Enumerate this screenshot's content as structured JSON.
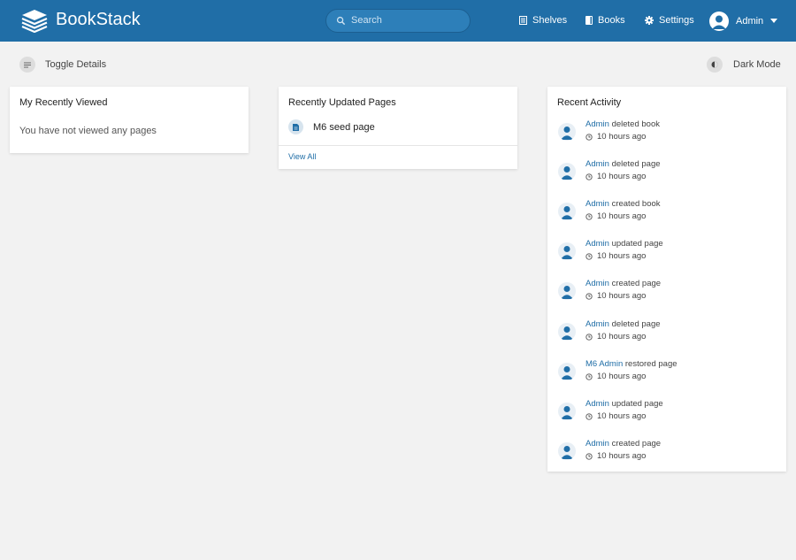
{
  "header": {
    "brand": "BookStack",
    "search_placeholder": "Search",
    "nav": {
      "shelves": "Shelves",
      "books": "Books",
      "settings": "Settings"
    },
    "user": "Admin",
    "color": "#206ea7"
  },
  "actions": {
    "toggle_details": "Toggle Details",
    "dark_mode": "Dark Mode"
  },
  "recently_viewed": {
    "title": "My Recently Viewed",
    "empty": "You have not viewed any pages"
  },
  "recently_updated": {
    "title": "Recently Updated Pages",
    "pages": [
      "M6 seed page"
    ],
    "view_all": "View All"
  },
  "recent_activity": {
    "title": "Recent Activity",
    "items": [
      {
        "user": "Admin",
        "action": "deleted book",
        "time": "10 hours ago"
      },
      {
        "user": "Admin",
        "action": "deleted page",
        "time": "10 hours ago"
      },
      {
        "user": "Admin",
        "action": "created book",
        "time": "10 hours ago"
      },
      {
        "user": "Admin",
        "action": "updated page",
        "time": "10 hours ago"
      },
      {
        "user": "Admin",
        "action": "created page",
        "time": "10 hours ago"
      },
      {
        "user": "Admin",
        "action": "deleted page",
        "time": "10 hours ago"
      },
      {
        "user": "M6 Admin",
        "action": "restored page",
        "time": "10 hours ago"
      },
      {
        "user": "Admin",
        "action": "updated page",
        "time": "10 hours ago"
      },
      {
        "user": "Admin",
        "action": "created page",
        "time": "10 hours ago"
      }
    ]
  }
}
